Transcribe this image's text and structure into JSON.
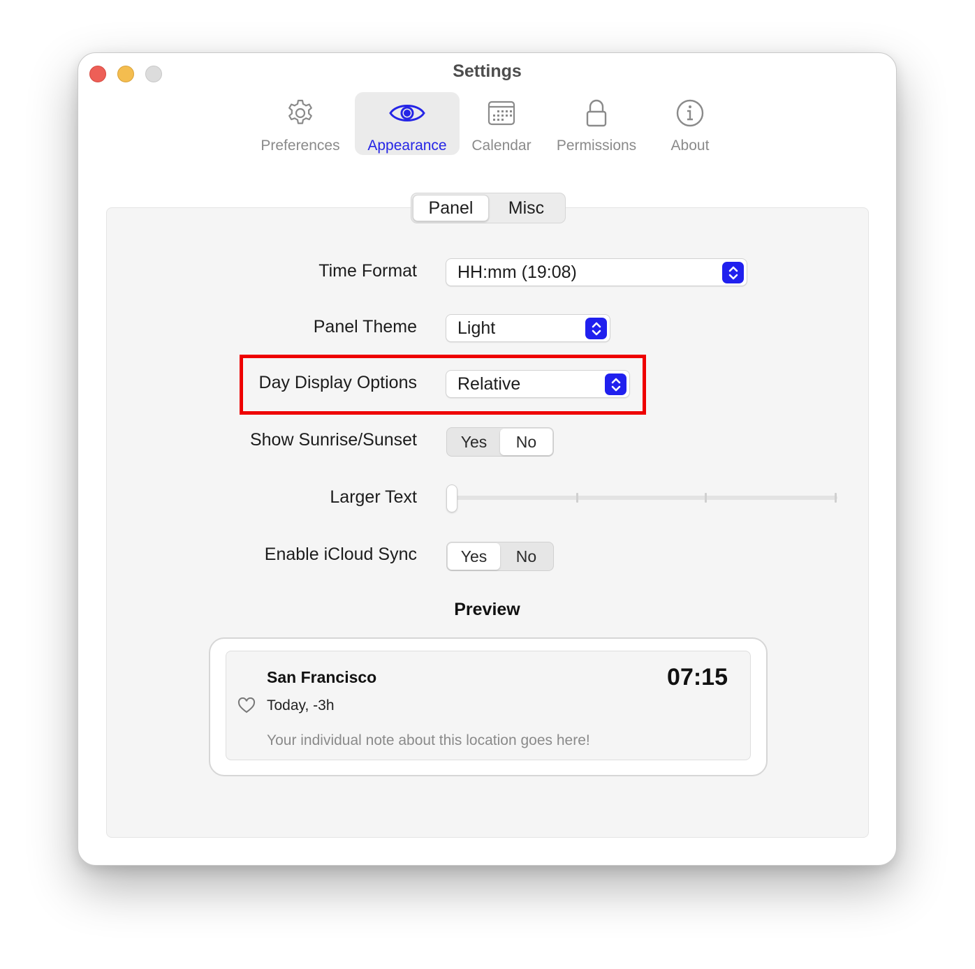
{
  "window": {
    "title": "Settings"
  },
  "toolbar": {
    "items": [
      {
        "label": "Preferences",
        "icon": "gear-icon"
      },
      {
        "label": "Appearance",
        "icon": "eye-icon"
      },
      {
        "label": "Calendar",
        "icon": "calendar-icon"
      },
      {
        "label": "Permissions",
        "icon": "lock-icon"
      },
      {
        "label": "About",
        "icon": "info-icon"
      }
    ],
    "selected": "Appearance"
  },
  "tabs": {
    "items": [
      "Panel",
      "Misc"
    ],
    "selected": "Panel"
  },
  "settings": {
    "time_format": {
      "label": "Time Format",
      "value": "HH:mm (19:08)"
    },
    "panel_theme": {
      "label": "Panel Theme",
      "value": "Light"
    },
    "day_display": {
      "label": "Day Display Options",
      "value": "Relative"
    },
    "sunrise_sunset": {
      "label": "Show Sunrise/Sunset",
      "yes": "Yes",
      "no": "No",
      "selected": "No"
    },
    "larger_text": {
      "label": "Larger Text",
      "level": 0,
      "steps": 4
    },
    "icloud_sync": {
      "label": "Enable iCloud Sync",
      "yes": "Yes",
      "no": "No",
      "selected": "Yes"
    }
  },
  "preview": {
    "title": "Preview",
    "city": "San Francisco",
    "time": "07:15",
    "day": "Today, -3h",
    "note": "Your individual note about this location goes here!"
  },
  "colors": {
    "accent": "#2020ee",
    "highlight": "#ee0000",
    "close": "#ed5f57",
    "minimize": "#f4bd4f"
  }
}
